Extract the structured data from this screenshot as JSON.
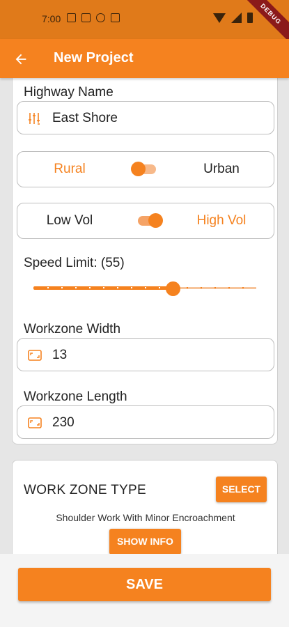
{
  "status_bar": {
    "time": "7:00"
  },
  "debug_banner": "DEBUG",
  "app_bar": {
    "title": "New Project"
  },
  "form": {
    "highway_name": {
      "label": "Highway Name",
      "value": "East Shore"
    },
    "area_toggle": {
      "left": "Rural",
      "right": "Urban",
      "selected": "Rural"
    },
    "volume_toggle": {
      "left": "Low Vol",
      "right": "High Vol",
      "selected": "High Vol"
    },
    "speed_limit": {
      "label": "Speed Limit: (55)",
      "value": 55,
      "fraction": 0.625,
      "divisions": 16
    },
    "workzone_width": {
      "label": "Workzone Width",
      "value": "13"
    },
    "workzone_length": {
      "label": "Workzone Length",
      "value": "230"
    }
  },
  "work_zone": {
    "title": "WORK ZONE TYPE",
    "select_label": "SELECT",
    "description": "Shoulder Work With Minor Encroachment",
    "info_label": "SHOW INFO"
  },
  "save_label": "SAVE",
  "colors": {
    "accent": "#f5821f",
    "status_bar": "#e07a1a",
    "debug": "#8b1a1a"
  }
}
